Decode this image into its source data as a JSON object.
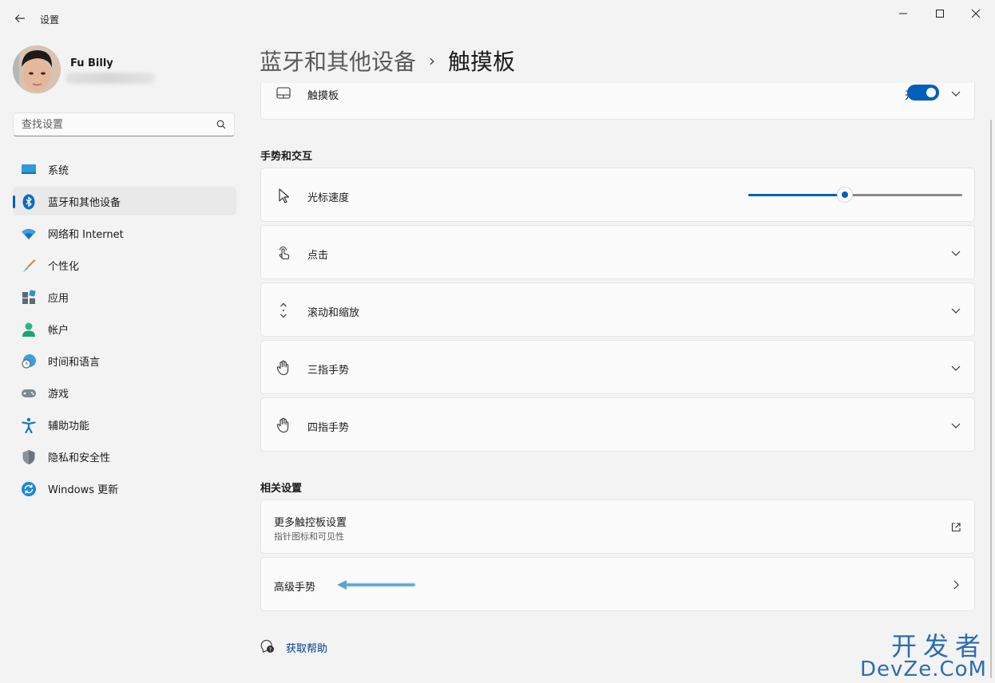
{
  "window": {
    "title": "设置"
  },
  "user": {
    "name": "Fu Billy"
  },
  "search": {
    "placeholder": "查找设置"
  },
  "sidebar": {
    "items": [
      {
        "label": "系统",
        "icon": "monitor-icon"
      },
      {
        "label": "蓝牙和其他设备",
        "icon": "bluetooth-icon",
        "active": true
      },
      {
        "label": "网络和 Internet",
        "icon": "wifi-icon"
      },
      {
        "label": "个性化",
        "icon": "brush-icon"
      },
      {
        "label": "应用",
        "icon": "apps-icon"
      },
      {
        "label": "帐户",
        "icon": "person-icon"
      },
      {
        "label": "时间和语言",
        "icon": "globe-clock-icon"
      },
      {
        "label": "游戏",
        "icon": "gamepad-icon"
      },
      {
        "label": "辅助功能",
        "icon": "accessibility-icon"
      },
      {
        "label": "隐私和安全性",
        "icon": "shield-icon"
      },
      {
        "label": "Windows 更新",
        "icon": "sync-icon"
      }
    ]
  },
  "breadcrumb": {
    "parent": "蓝牙和其他设备",
    "separator": "›",
    "current": "触摸板"
  },
  "touchpad": {
    "label": "触摸板",
    "toggle_text": "开",
    "toggle_on": true
  },
  "gestures_section": {
    "title": "手势和交互",
    "cursor_speed": {
      "label": "光标速度",
      "value_fraction": 0.45
    },
    "rows": [
      {
        "label": "点击",
        "icon": "tap-icon"
      },
      {
        "label": "滚动和缩放",
        "icon": "scroll-icon"
      },
      {
        "label": "三指手势",
        "icon": "hand-icon"
      },
      {
        "label": "四指手势",
        "icon": "hand-icon"
      }
    ]
  },
  "related_section": {
    "title": "相关设置",
    "more": {
      "label": "更多触控板设置",
      "sub": "指针图标和可见性"
    },
    "advanced": {
      "label": "高级手势"
    }
  },
  "help": {
    "label": "获取帮助"
  },
  "watermark": {
    "cn": "开发者",
    "en": "DevZe.CoM"
  },
  "colors": {
    "accent": "#005fb8",
    "background": "#f3f3f3",
    "card": "#fbfbfb"
  }
}
